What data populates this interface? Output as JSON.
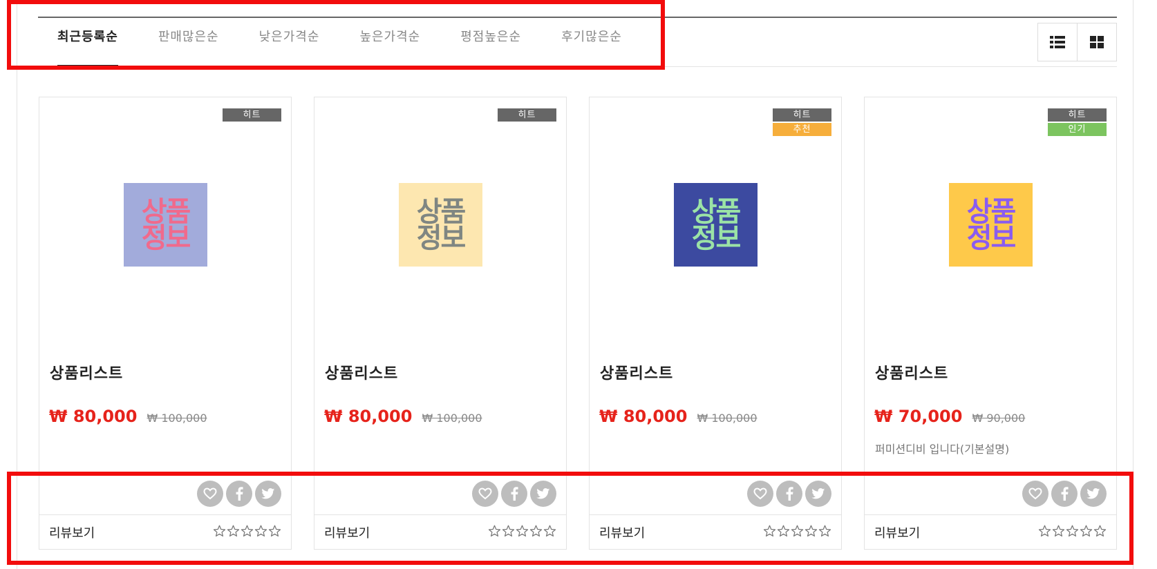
{
  "sort": {
    "tabs": [
      {
        "label": "최근등록순",
        "active": true
      },
      {
        "label": "판매많은순",
        "active": false
      },
      {
        "label": "낮은가격순",
        "active": false
      },
      {
        "label": "높은가격순",
        "active": false
      },
      {
        "label": "평점높은순",
        "active": false
      },
      {
        "label": "후기많은순",
        "active": false
      }
    ],
    "view_icons": [
      "list-view-icon",
      "grid-view-icon"
    ]
  },
  "products": [
    {
      "badges": [
        {
          "label": "히트",
          "color": "#666666"
        }
      ],
      "thumb": {
        "line1": "상품",
        "line2": "정보",
        "bg": "#a2abdb",
        "fg": "#f06a8c"
      },
      "name": "상품리스트",
      "price": "₩ 80,000",
      "original_price": "₩ 100,000",
      "desc": "",
      "review_label": "리뷰보기"
    },
    {
      "badges": [
        {
          "label": "히트",
          "color": "#666666"
        }
      ],
      "thumb": {
        "line1": "상품",
        "line2": "정보",
        "bg": "#fde7b0",
        "fg": "#7f8682"
      },
      "name": "상품리스트",
      "price": "₩ 80,000",
      "original_price": "₩ 100,000",
      "desc": "",
      "review_label": "리뷰보기"
    },
    {
      "badges": [
        {
          "label": "히트",
          "color": "#666666"
        },
        {
          "label": "추천",
          "color": "#f6ae3b"
        }
      ],
      "thumb": {
        "line1": "상품",
        "line2": "정보",
        "bg": "#3c4aa0",
        "fg": "#9be3a6"
      },
      "name": "상품리스트",
      "price": "₩ 80,000",
      "original_price": "₩ 100,000",
      "desc": "",
      "review_label": "리뷰보기"
    },
    {
      "badges": [
        {
          "label": "히트",
          "color": "#666666"
        },
        {
          "label": "인기",
          "color": "#7cc45f"
        }
      ],
      "thumb": {
        "line1": "상품",
        "line2": "정보",
        "bg": "#fec94a",
        "fg": "#8a5cf0"
      },
      "name": "상품리스트",
      "price": "₩ 70,000",
      "original_price": "₩ 90,000",
      "desc": "퍼미션디비 입니다(기본설명)",
      "review_label": "리뷰보기"
    }
  ],
  "social_icons": [
    "heart-icon",
    "facebook-icon",
    "twitter-icon"
  ],
  "colors": {
    "price": "#e6231b",
    "annotation": "#f20c0c"
  }
}
